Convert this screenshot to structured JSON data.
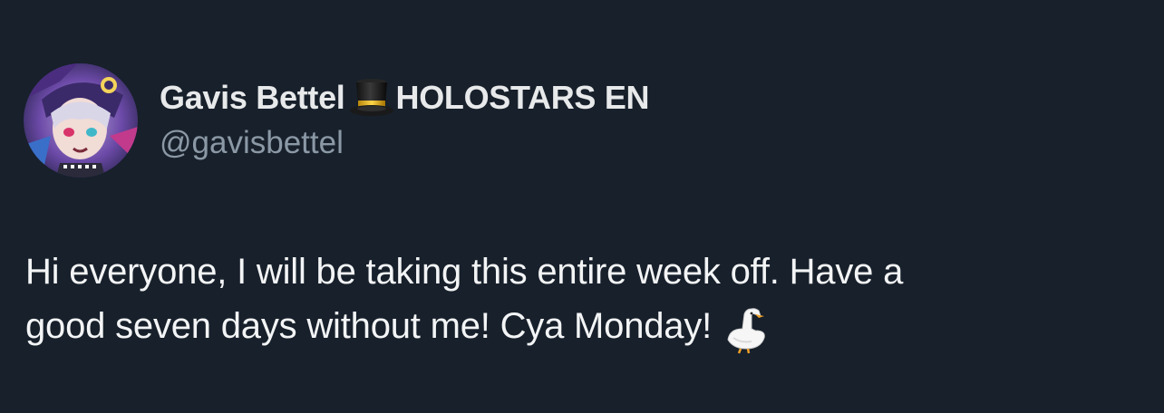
{
  "tweet": {
    "author": {
      "display_name": "Gavis Bettel",
      "name_suffix": "HOLOSTARS EN",
      "name_emoji": "top-hat-icon",
      "handle": "@gavisbettel",
      "avatar": "avatar-image"
    },
    "text_line_1": "Hi everyone, I will be taking this entire week off. Have a",
    "text_line_2": "good seven days without me! Cya Monday!",
    "text_emoji": "goose-icon"
  },
  "colors": {
    "background": "#17202b",
    "primary_text": "#e7e9ea",
    "secondary_text": "#8b98a5"
  }
}
